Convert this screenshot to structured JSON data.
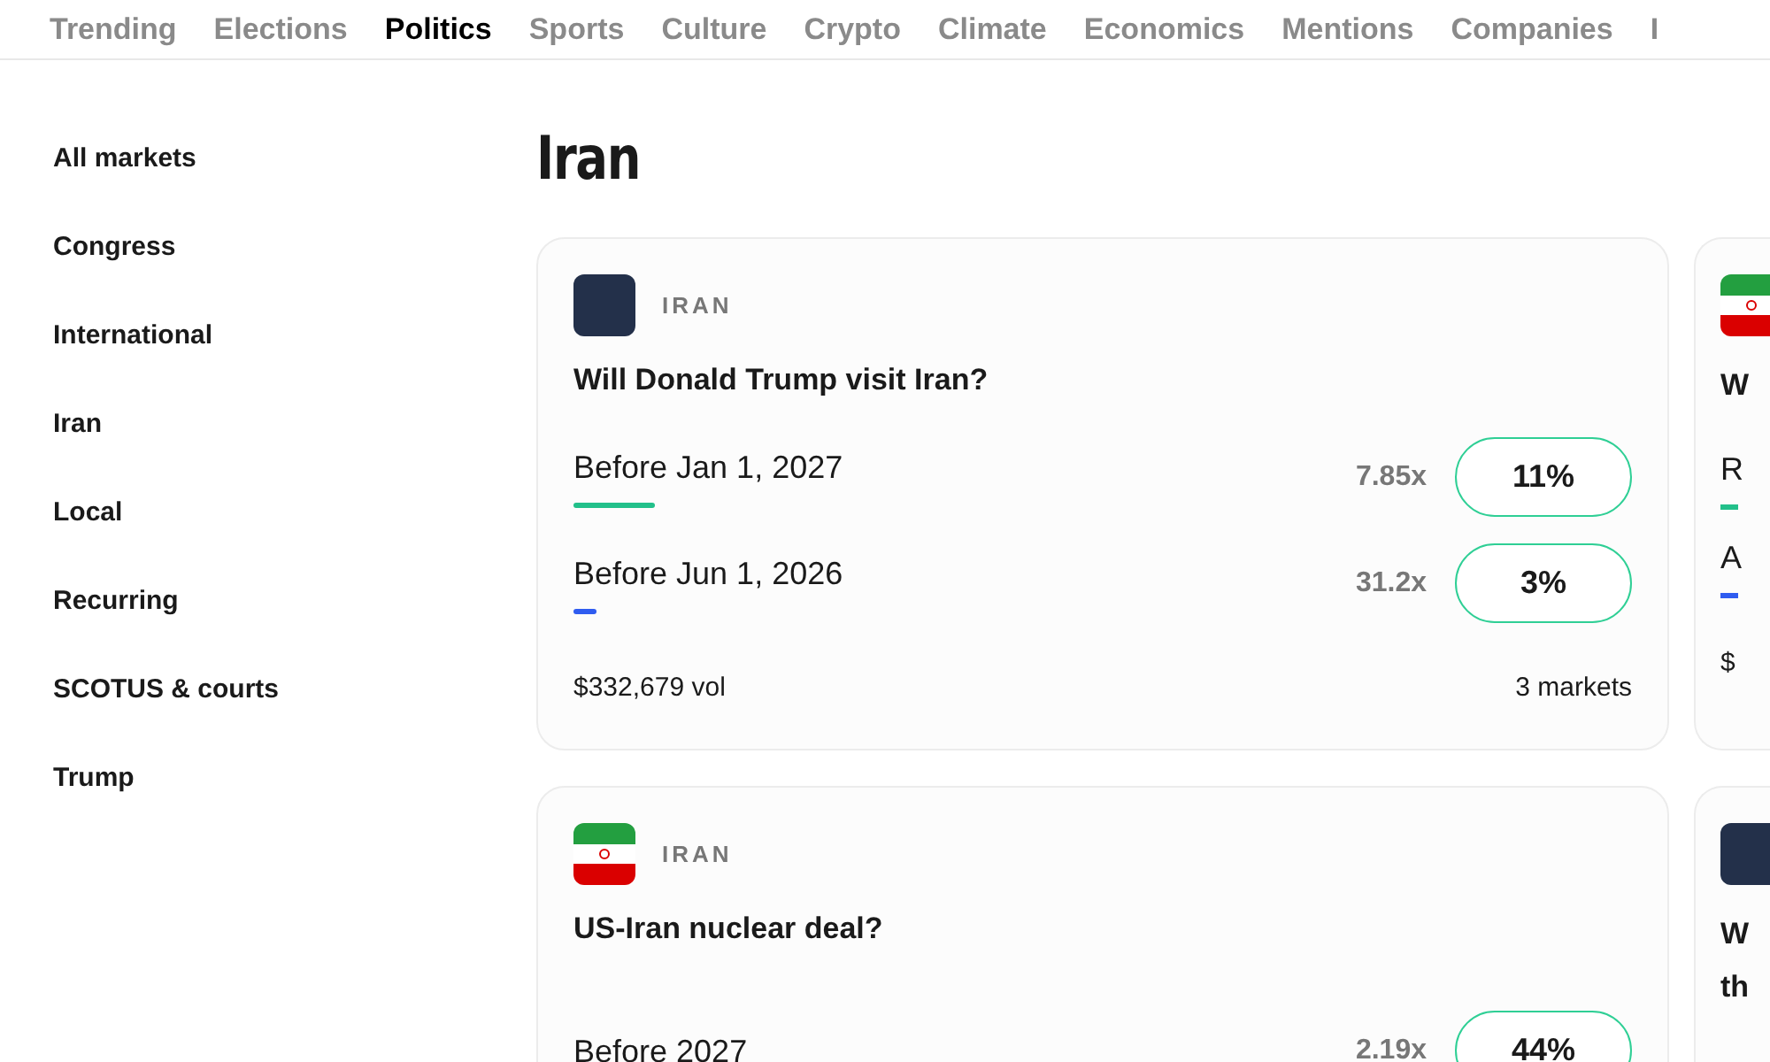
{
  "nav": [
    {
      "label": "Trending",
      "selected": false
    },
    {
      "label": "Elections",
      "selected": false
    },
    {
      "label": "Politics",
      "selected": true
    },
    {
      "label": "Sports",
      "selected": false
    },
    {
      "label": "Culture",
      "selected": false
    },
    {
      "label": "Crypto",
      "selected": false
    },
    {
      "label": "Climate",
      "selected": false
    },
    {
      "label": "Economics",
      "selected": false
    },
    {
      "label": "Mentions",
      "selected": false
    },
    {
      "label": "Companies",
      "selected": false
    },
    {
      "label": "I",
      "selected": false
    }
  ],
  "sidebar": {
    "items": [
      {
        "label": "All markets"
      },
      {
        "label": "Congress"
      },
      {
        "label": "International"
      },
      {
        "label": "Iran"
      },
      {
        "label": "Local"
      },
      {
        "label": "Recurring"
      },
      {
        "label": "SCOTUS & courts"
      },
      {
        "label": "Trump"
      }
    ]
  },
  "heading": "Iran",
  "cards": [
    {
      "kind": "photo",
      "category": "IRAN",
      "title": "Will Donald Trump visit Iran?",
      "options": [
        {
          "label": "Before Jan 1, 2027",
          "color": "#22c08a",
          "level": 0.11,
          "multiplier": "7.85x",
          "chance": "11%"
        },
        {
          "label": "Before Jun 1, 2026",
          "color": "#2f5cf0",
          "level": 0.03,
          "multiplier": "31.2x",
          "chance": "3%"
        }
      ],
      "volume": "$332,679 vol",
      "markets": "3 markets"
    },
    {
      "kind": "flag",
      "category": "IRAN",
      "title": "US-Iran nuclear deal?",
      "options": [
        {
          "label": "Before 2027",
          "multiplier": "2.19x",
          "chance": "44%"
        }
      ]
    }
  ],
  "side_cards": [
    {
      "kind": "flag",
      "title_lines": [
        "W"
      ],
      "options": [
        {
          "label": "R",
          "color": "#22c08a"
        },
        {
          "label": "A",
          "color": "#2f5cf0"
        }
      ],
      "volume": "$"
    },
    {
      "kind": "photo",
      "title_lines": [
        "W",
        "th"
      ]
    }
  ]
}
